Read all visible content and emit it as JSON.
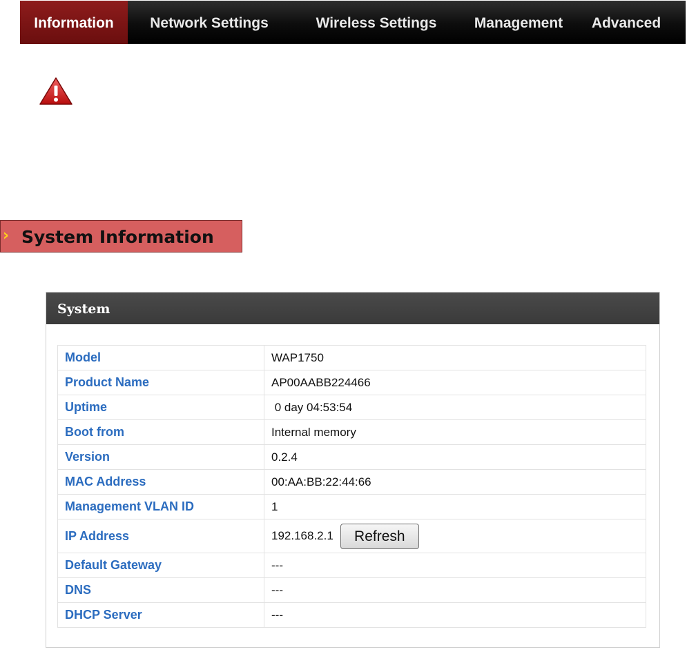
{
  "nav": {
    "tabs": [
      {
        "label": "Information",
        "active": true
      },
      {
        "label": "Network Settings",
        "active": false
      },
      {
        "label": "Wireless Settings",
        "active": false
      },
      {
        "label": "Management",
        "active": false
      },
      {
        "label": "Advanced",
        "active": false
      }
    ]
  },
  "warning": {
    "icon": "warning-triangle-icon",
    "color": "#cc1111"
  },
  "section": {
    "title": "System Information",
    "chevron": "›"
  },
  "panel": {
    "title": "System",
    "rows": [
      {
        "label": "Model",
        "value": "WAP1750"
      },
      {
        "label": "Product Name",
        "value": "AP00AABB224466"
      },
      {
        "label": "Uptime",
        "value": " 0 day 04:53:54"
      },
      {
        "label": "Boot from",
        "value": "Internal memory"
      },
      {
        "label": "Version",
        "value": "0.2.4"
      },
      {
        "label": "MAC Address",
        "value": "00:AA:BB:22:44:66"
      },
      {
        "label": "Management VLAN ID",
        "value": "1"
      },
      {
        "label": "IP Address",
        "value": "192.168.2.1"
      },
      {
        "label": "Default Gateway",
        "value": "---"
      },
      {
        "label": "DNS",
        "value": "---"
      },
      {
        "label": "DHCP Server",
        "value": "---"
      }
    ],
    "refresh_label": "Refresh"
  },
  "colors": {
    "accent": "#8e1c1c",
    "label_blue": "#2b6cbf",
    "section_bg": "#d65f5f"
  }
}
